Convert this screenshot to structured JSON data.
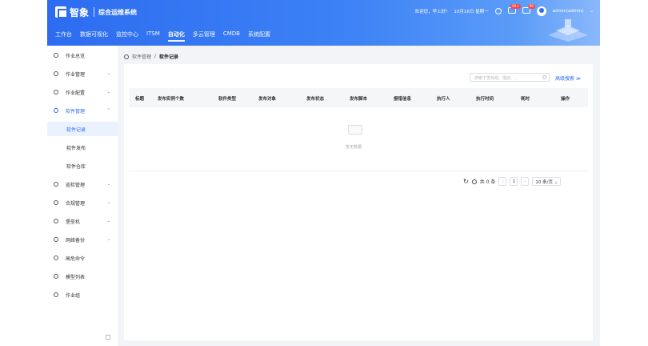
{
  "header": {
    "brand": "智象",
    "subtitle": "综合运维系统",
    "greeting": "欢迎您，早上好!",
    "date": "10月16日 星期一",
    "badge1": "99+",
    "badge2": "99",
    "user": "admin(admin)",
    "nav": [
      "工作台",
      "数据可视化",
      "监控中心",
      "ITSM",
      "自动化",
      "多云管理",
      "CMDB",
      "系统配置"
    ],
    "active_nav": "自动化"
  },
  "sidebar": {
    "items": [
      {
        "label": "作业总览",
        "icon": "overview-icon",
        "chevron": ""
      },
      {
        "label": "作业管理",
        "icon": "job-manage-icon",
        "chevron": "⌄"
      },
      {
        "label": "作业配置",
        "icon": "job-config-icon",
        "chevron": "⌄"
      },
      {
        "label": "软件管理",
        "icon": "software-icon",
        "chevron": "⌃"
      },
      {
        "label": "巡检管理",
        "icon": "inspect-icon",
        "chevron": "⌄"
      },
      {
        "label": "合规管理",
        "icon": "compliance-icon",
        "chevron": "⌄"
      },
      {
        "label": "堡垒机",
        "icon": "bastion-icon",
        "chevron": "⌄"
      },
      {
        "label": "网络备份",
        "icon": "backup-icon",
        "chevron": "⌄"
      },
      {
        "label": "高危命令",
        "icon": "danger-icon",
        "chevron": ""
      },
      {
        "label": "模型列表",
        "icon": "model-icon",
        "chevron": ""
      },
      {
        "label": "作业组",
        "icon": "group-icon",
        "chevron": ""
      }
    ],
    "sub_items": [
      "软件记录",
      "软件发布",
      "软件仓库"
    ]
  },
  "breadcrumb": {
    "parent": "软件管理",
    "sep": "/",
    "current": "软件记录"
  },
  "search": {
    "placeholder": "搜索下发标题、描述、...",
    "advanced": "高级搜索 ≫"
  },
  "table": {
    "columns": [
      "标题",
      "发布实例个数",
      "软件类型",
      "发布对象",
      "发布状态",
      "发布脚本",
      "报错信息",
      "执行人",
      "执行时间",
      "耗时",
      "操作"
    ],
    "empty_text": "暂无数据"
  },
  "pager": {
    "total": "共 0 条",
    "page": "1",
    "size": "10 条/页 ⌄"
  }
}
